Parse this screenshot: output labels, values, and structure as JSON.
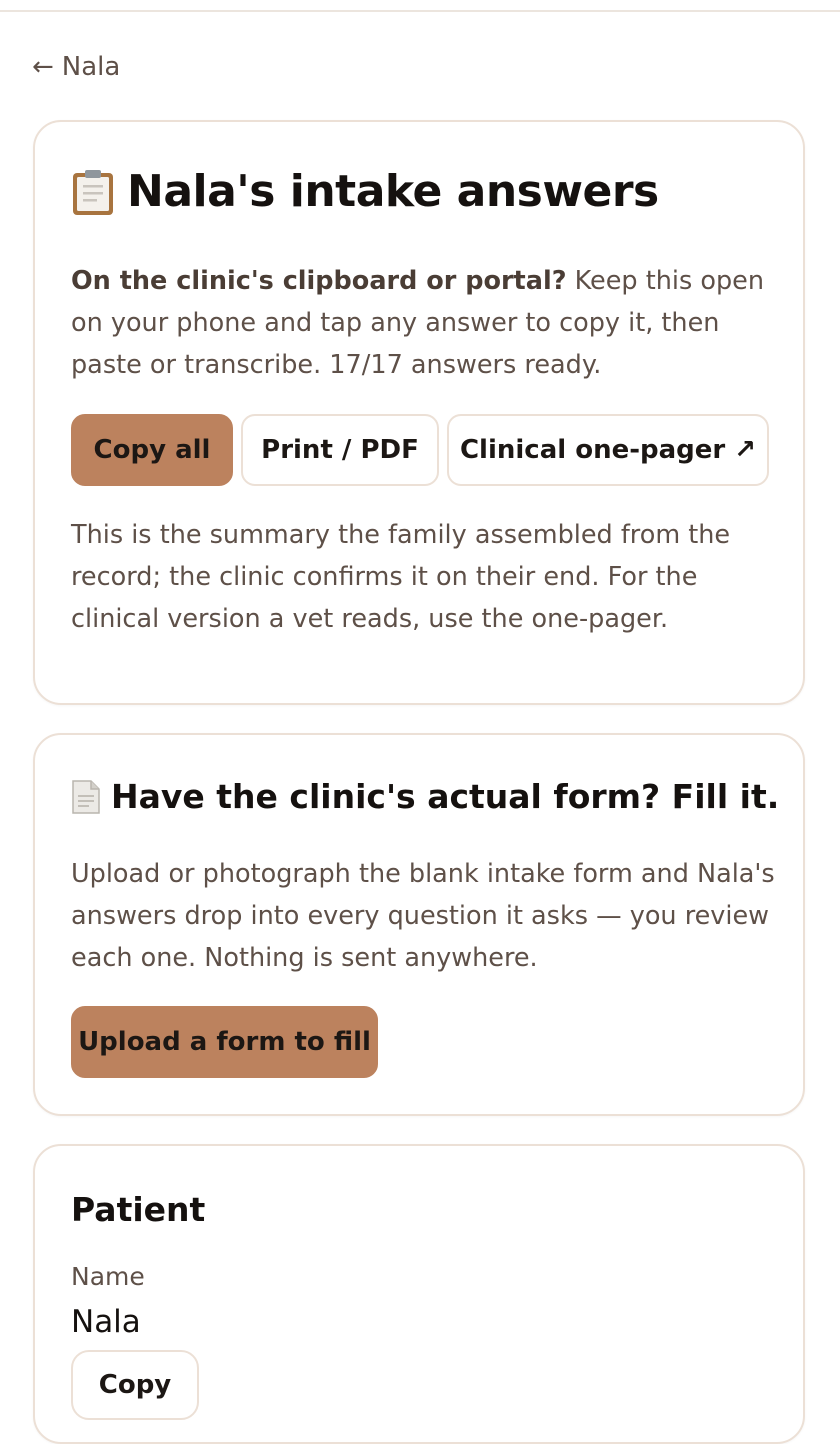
{
  "back": {
    "label": "Nala"
  },
  "intake": {
    "title": "Nala's intake answers",
    "lead_bold": "On the clinic's clipboard or portal?",
    "lead_text": " Keep this open on your phone and tap any answer to copy it, then paste or transcribe. 17/17 answers ready.",
    "buttons": {
      "copy_all": "Copy all",
      "print": "Print / PDF",
      "one_pager": "Clinical one-pager ↗"
    },
    "note": "This is the summary the family assembled from the record; the clinic confirms it on their end. For the clinical version a vet reads, use the one-pager."
  },
  "fill_form": {
    "title": "Have the clinic's actual form? Fill it.",
    "description": "Upload or photograph the blank intake form and Nala's answers drop into every question it asks — you review each one. Nothing is sent anywhere.",
    "upload_label": "Upload a form to fill"
  },
  "patient": {
    "section_title": "Patient",
    "name_label": "Name",
    "name_value": "Nala",
    "copy_label": "Copy"
  },
  "colors": {
    "accent": "#bc825e",
    "border": "#ece0d6",
    "muted_text": "#5e5048",
    "heading_text": "#15110f"
  }
}
